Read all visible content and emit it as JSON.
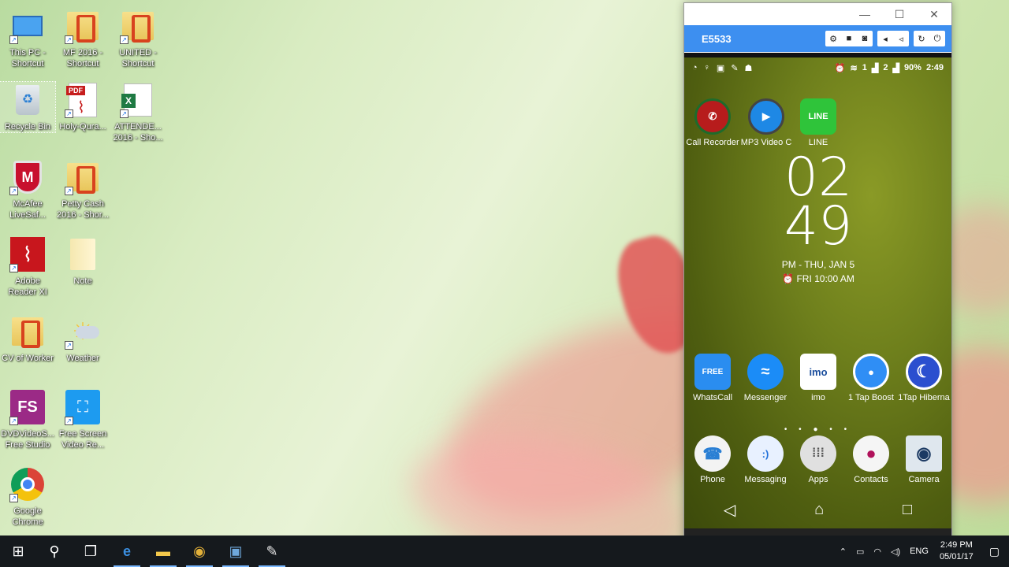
{
  "desktop": {
    "icons": [
      {
        "label": "This PC - Shortcut",
        "icon": "computer-icon"
      },
      {
        "label": "MF 2016 - Shortcut",
        "icon": "folder-icon"
      },
      {
        "label": "UNITED - Shortcut",
        "icon": "folder-icon"
      },
      {
        "label": "Recycle Bin",
        "icon": "recycle-bin-icon"
      },
      {
        "label": "Holy-Qura...",
        "icon": "pdf-icon"
      },
      {
        "label": "ATTENDE... 2016 - Sho...",
        "icon": "excel-icon"
      },
      {
        "label": "McAfee LiveSaf...",
        "icon": "mcafee-icon"
      },
      {
        "label": "Petty Cash 2016 - Shor...",
        "icon": "folder-icon"
      },
      {
        "label": "Adobe Reader XI",
        "icon": "adobe-reader-icon"
      },
      {
        "label": "Note",
        "icon": "folder-icon"
      },
      {
        "label": "CV of Worker",
        "icon": "folder-icon"
      },
      {
        "label": "Weather",
        "icon": "weather-icon"
      },
      {
        "label": "DVDVideoS... Free Studio",
        "icon": "fs-icon"
      },
      {
        "label": "Free Screen Video Re...",
        "icon": "screen-recorder-icon"
      },
      {
        "label": "Google Chrome",
        "icon": "chrome-icon"
      }
    ]
  },
  "taskbar": {
    "tray_lang": "ENG",
    "time": "2:49 PM",
    "date": "05/01/17"
  },
  "phone_window": {
    "device_name": "E5533",
    "status": {
      "battery": "90%",
      "time": "2:49",
      "sim1": "1",
      "sim2": "2"
    },
    "top_apps": [
      {
        "label": "Call Recorder",
        "color": "#b71c1c"
      },
      {
        "label": "MP3 Video C",
        "color": "#1e88e5"
      },
      {
        "label": "LINE",
        "color": "#2fc43a",
        "text": "LINE"
      }
    ],
    "clock": {
      "hours": "02",
      "minutes": "49",
      "date": "PM - THU, JAN 5",
      "alarm": "FRI 10:00 AM"
    },
    "apps_row": [
      {
        "label": "WhatsCall",
        "color": "#2a8df0",
        "text": "FREE"
      },
      {
        "label": "Messenger",
        "color": "#1b8cf7",
        "text": "≈"
      },
      {
        "label": "imo",
        "color": "#ffffff",
        "text": "imo"
      },
      {
        "label": "1 Tap Boost",
        "color": "#2f8ef5",
        "text": "●"
      },
      {
        "label": "1Tap Hiberna",
        "color": "#2b4fcf",
        "text": "☾"
      }
    ],
    "dock": [
      {
        "label": "Phone",
        "color": "#f3f3f3",
        "text": "☎"
      },
      {
        "label": "Messaging",
        "color": "#e8f1ff",
        "text": ":)"
      },
      {
        "label": "Apps",
        "color": "#e0e0e0",
        "text": "⁞⁞⁞"
      },
      {
        "label": "Contacts",
        "color": "#f5f5f5",
        "text": "●"
      },
      {
        "label": "Camera",
        "color": "#dfe7ee",
        "text": "◉"
      }
    ],
    "page_dots": "• • ● • •"
  }
}
